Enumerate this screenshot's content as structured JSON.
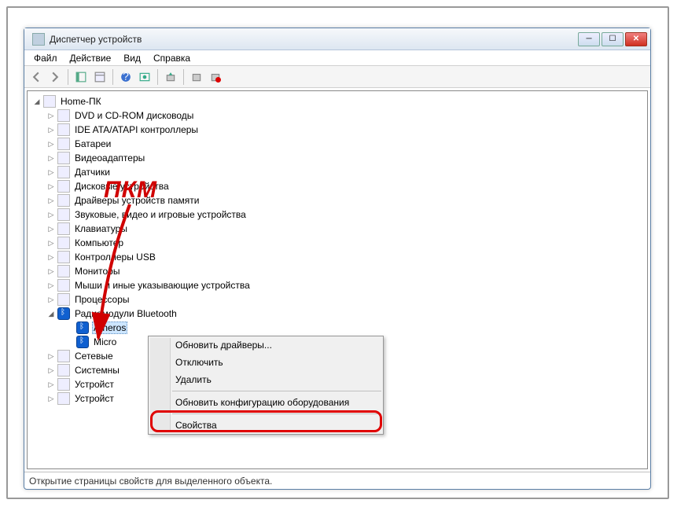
{
  "window": {
    "title": "Диспетчер устройств"
  },
  "menu": {
    "file": "Файл",
    "action": "Действие",
    "view": "Вид",
    "help": "Справка"
  },
  "tree": {
    "root": "Home-ПК",
    "cat_dvd": "DVD и CD-ROM дисководы",
    "cat_ide": "IDE ATA/ATAPI контроллеры",
    "cat_battery": "Батареи",
    "cat_video": "Видеоадаптеры",
    "cat_sensors": "Датчики",
    "cat_disk": "Дисковые устройства",
    "cat_memdrv": "Драйверы устройств памяти",
    "cat_audio": "Звуковые, видео и игровые устройства",
    "cat_keyboard": "Клавиатуры",
    "cat_computer": "Компьютер",
    "cat_usb": "Контроллеры USB",
    "cat_monitor": "Мониторы",
    "cat_mouse": "Мыши и иные указывающие устройства",
    "cat_cpu": "Процессоры",
    "cat_bt": "Радиомодули Bluetooth",
    "bt_atheros": "Atheros",
    "bt_msft": "Micro",
    "cat_net": "Сетевые",
    "cat_system": "Системны",
    "cat_hid": "Устройст",
    "cat_imaging": "Устройст"
  },
  "context_menu": {
    "update": "Обновить драйверы...",
    "disable": "Отключить",
    "delete": "Удалить",
    "scan": "Обновить конфигурацию оборудования",
    "properties": "Свойства"
  },
  "statusbar": {
    "text": "Открытие страницы свойств для выделенного объекта."
  },
  "annotation": {
    "pkm": "ПКМ"
  }
}
